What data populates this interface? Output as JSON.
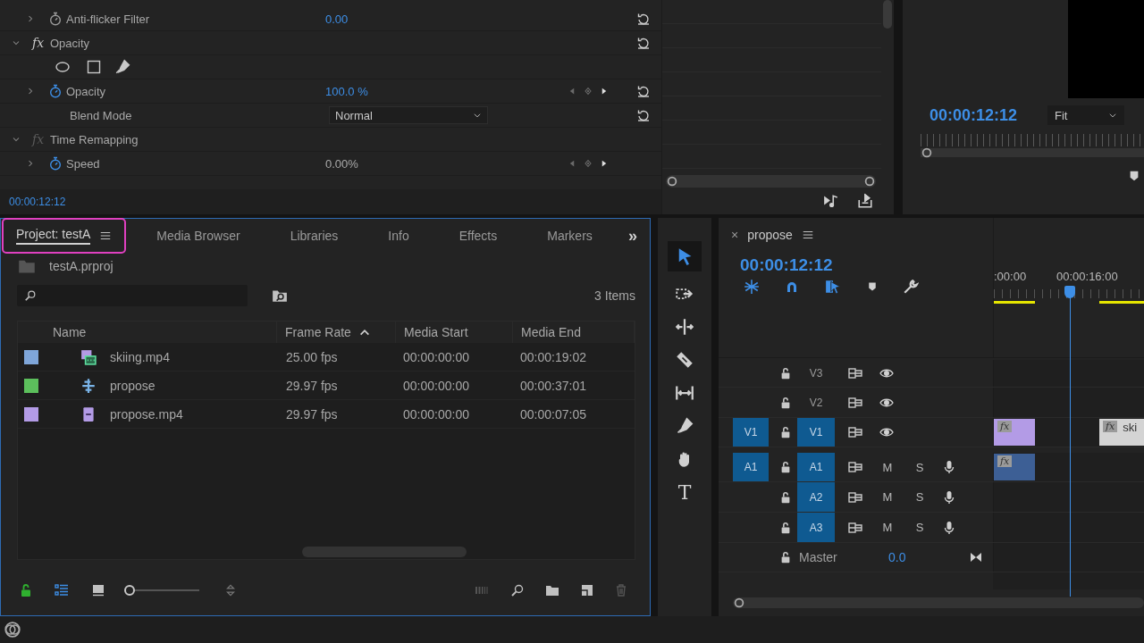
{
  "effect_controls": {
    "rows": [
      {
        "kind": "param",
        "label": "Anti-flicker Filter",
        "value": "0.00",
        "expanded": false,
        "animated": false,
        "disabled": false,
        "keyframe_nav": false,
        "resettable": true
      },
      {
        "kind": "section",
        "badge": "fx",
        "label": "Opacity",
        "expanded": true,
        "enabled": true,
        "resettable": true
      },
      {
        "kind": "mask_tools"
      },
      {
        "kind": "param",
        "label": "Opacity",
        "value": "100.0 %",
        "expanded": false,
        "animated": true,
        "disabled": false,
        "keyframe_nav": true,
        "resettable": true
      },
      {
        "kind": "dropdown",
        "label": "Blend Mode",
        "value": "Normal",
        "resettable": true
      },
      {
        "kind": "section",
        "badge": "fx",
        "label": "Time Remapping",
        "expanded": true,
        "enabled": false,
        "resettable": false
      },
      {
        "kind": "param",
        "label": "Speed",
        "value": "0.00%",
        "expanded": false,
        "animated": true,
        "disabled": true,
        "keyframe_nav": true,
        "resettable": false
      }
    ],
    "timecode": "00:00:12:12"
  },
  "program_monitor": {
    "timecode": "00:00:12:12",
    "zoom": "Fit"
  },
  "project": {
    "tabs": [
      {
        "label": "Project: testA",
        "selected": true,
        "highlighted": true,
        "menu": true
      },
      {
        "label": "Media Browser",
        "selected": false,
        "highlighted": false,
        "menu": false
      },
      {
        "label": "Libraries",
        "selected": false,
        "highlighted": false,
        "menu": false
      },
      {
        "label": "Info",
        "selected": false,
        "highlighted": false,
        "menu": false
      },
      {
        "label": "Effects",
        "selected": false,
        "highlighted": false,
        "menu": false
      },
      {
        "label": "Markers",
        "selected": false,
        "highlighted": false,
        "menu": false
      }
    ],
    "overflow": "»",
    "file": "testA.prproj",
    "item_count": "3 Items",
    "columns": [
      {
        "label": "Name",
        "sorted": false
      },
      {
        "label": "Frame Rate",
        "sorted": true
      },
      {
        "label": "Media Start",
        "sorted": false
      },
      {
        "label": "Media End",
        "sorted": false
      }
    ],
    "rows": [
      {
        "color": "#7fa6d9",
        "kind": "video_audio",
        "name": "skiing.mp4",
        "frame_rate": "25.00 fps",
        "media_start": "00:00:00:00",
        "media_end": "00:00:19:02"
      },
      {
        "color": "#5cbf5c",
        "kind": "sequence",
        "name": "propose",
        "frame_rate": "29.97 fps",
        "media_start": "00:00:00:00",
        "media_end": "00:00:37:01"
      },
      {
        "color": "#b39be6",
        "kind": "video",
        "name": "propose.mp4",
        "frame_rate": "29.97 fps",
        "media_start": "00:00:00:00",
        "media_end": "00:00:07:05"
      }
    ],
    "view_modes": [
      {
        "kind": "list",
        "selected": true
      },
      {
        "kind": "icon",
        "selected": false
      }
    ],
    "zoom": {
      "level": 0
    }
  },
  "tools": [
    {
      "kind": "selection",
      "selected": true
    },
    {
      "kind": "track_select",
      "selected": false
    },
    {
      "kind": "ripple",
      "selected": false
    },
    {
      "kind": "razor",
      "selected": false
    },
    {
      "kind": "slip",
      "selected": false
    },
    {
      "kind": "pen",
      "selected": false
    },
    {
      "kind": "hand",
      "selected": false
    },
    {
      "kind": "type",
      "selected": false,
      "glyph": "T"
    }
  ],
  "timeline": {
    "sequence": "propose",
    "close": "×",
    "timecode": "00:00:12:12",
    "ruler_labels": [
      ":00:00",
      "00:00:16:00"
    ],
    "tracks": [
      {
        "kind": "video",
        "name": "V3",
        "targeted": false
      },
      {
        "kind": "video",
        "name": "V2",
        "targeted": false
      },
      {
        "kind": "video",
        "name": "V1",
        "targeted": true,
        "source": "V1",
        "clips": [
          {
            "color": "#b39be6",
            "badge": "fx"
          },
          {
            "color": "#d4d4d4",
            "badge": "fx",
            "label": "ski"
          }
        ]
      },
      {
        "kind": "audio",
        "name": "A1",
        "targeted": true,
        "source": "A1",
        "mute": "M",
        "solo": "S",
        "clips": [
          {
            "color": "#3d5f95",
            "badge": "fx"
          }
        ]
      },
      {
        "kind": "audio",
        "name": "A2",
        "targeted": true,
        "mute": "M",
        "solo": "S"
      },
      {
        "kind": "audio",
        "name": "A3",
        "targeted": true,
        "mute": "M",
        "solo": "S"
      },
      {
        "kind": "master",
        "name": "Master",
        "value": "0.0"
      }
    ]
  }
}
